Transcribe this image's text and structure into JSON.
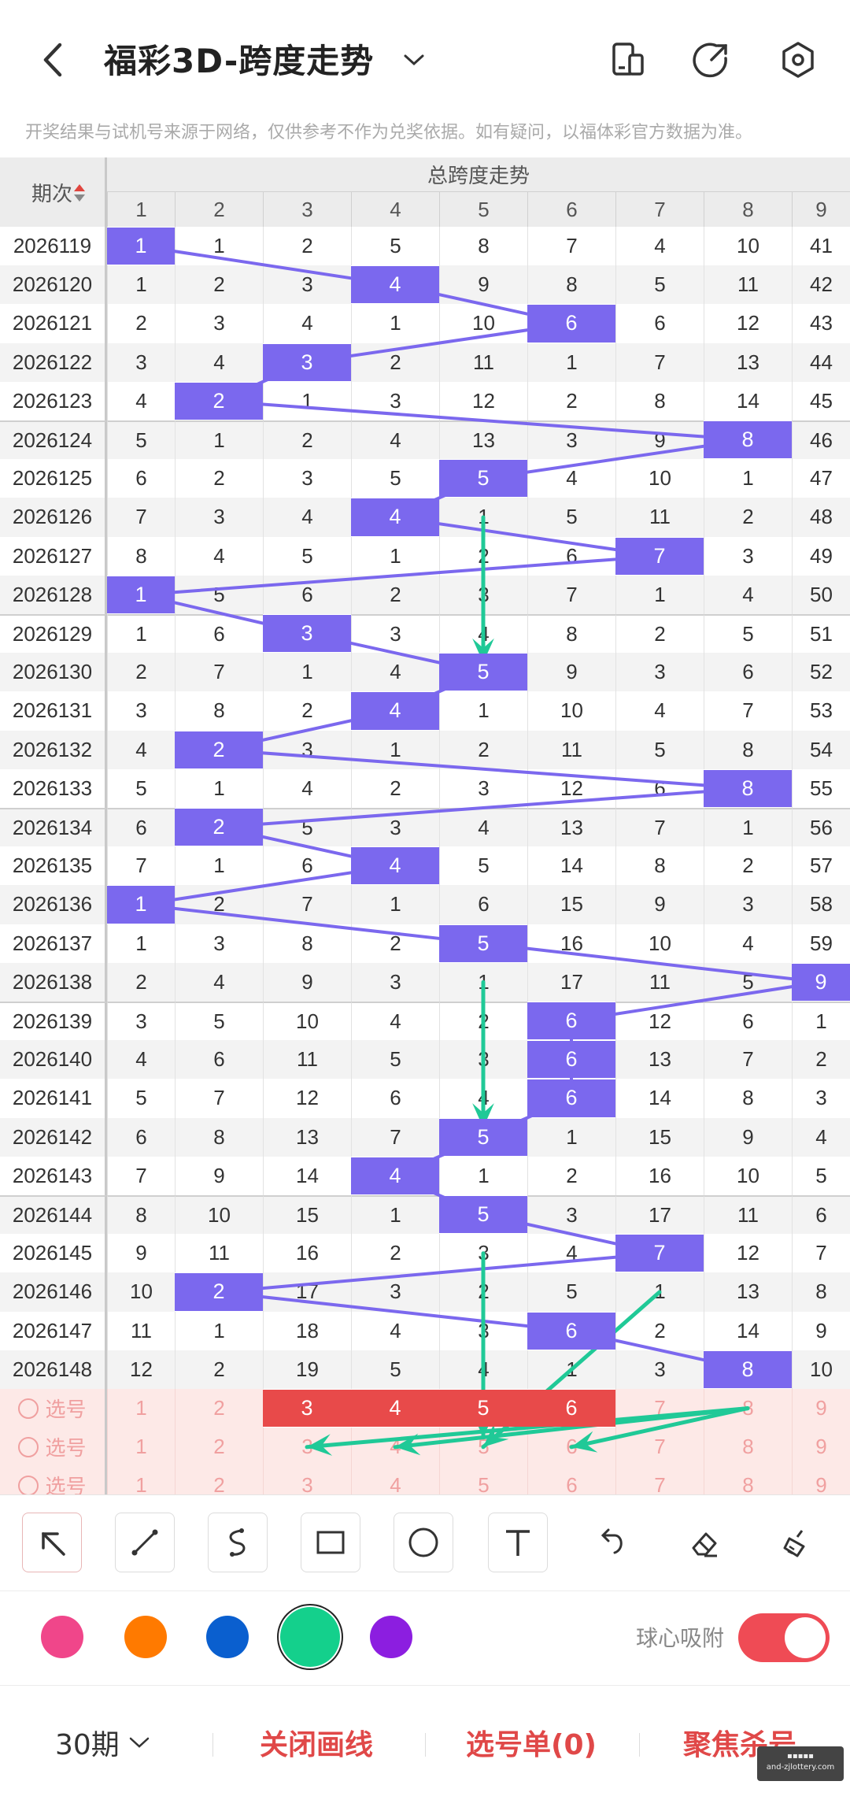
{
  "header": {
    "title": "福彩3D-跨度走势",
    "back_icon": "back-arrow-icon",
    "icons": [
      "layout-icon",
      "share-icon",
      "settings-hex-icon"
    ]
  },
  "notice": "开奖结果与试机号来源于网络，仅供参考不作为兑奖依据。如有疑问，以福体彩官方数据为准。",
  "table": {
    "period_header": "期次",
    "group_header": "总跨度走势",
    "columns": [
      "1",
      "2",
      "3",
      "4",
      "5",
      "6",
      "7",
      "8",
      "9"
    ],
    "rows": [
      {
        "period": "2026119",
        "vals": [
          "1",
          "1",
          "2",
          "5",
          "8",
          "7",
          "4",
          "10",
          "41"
        ],
        "hit": 1
      },
      {
        "period": "2026120",
        "vals": [
          "1",
          "2",
          "3",
          "4",
          "9",
          "8",
          "5",
          "11",
          "42"
        ],
        "hit": 4
      },
      {
        "period": "2026121",
        "vals": [
          "2",
          "3",
          "4",
          "1",
          "10",
          "6",
          "6",
          "12",
          "43"
        ],
        "hit": 6
      },
      {
        "period": "2026122",
        "vals": [
          "3",
          "4",
          "3",
          "2",
          "11",
          "1",
          "7",
          "13",
          "44"
        ],
        "hit": 3
      },
      {
        "period": "2026123",
        "vals": [
          "4",
          "2",
          "1",
          "3",
          "12",
          "2",
          "8",
          "14",
          "45"
        ],
        "hit": 2
      },
      {
        "period": "2026124",
        "vals": [
          "5",
          "1",
          "2",
          "4",
          "13",
          "3",
          "9",
          "8",
          "46"
        ],
        "hit": 8
      },
      {
        "period": "2026125",
        "vals": [
          "6",
          "2",
          "3",
          "5",
          "5",
          "4",
          "10",
          "1",
          "47"
        ],
        "hit": 5
      },
      {
        "period": "2026126",
        "vals": [
          "7",
          "3",
          "4",
          "4",
          "1",
          "5",
          "11",
          "2",
          "48"
        ],
        "hit": 4
      },
      {
        "period": "2026127",
        "vals": [
          "8",
          "4",
          "5",
          "1",
          "2",
          "6",
          "7",
          "3",
          "49"
        ],
        "hit": 7
      },
      {
        "period": "2026128",
        "vals": [
          "1",
          "5",
          "6",
          "2",
          "3",
          "7",
          "1",
          "4",
          "50"
        ],
        "hit": 1
      },
      {
        "period": "2026129",
        "vals": [
          "1",
          "6",
          "3",
          "3",
          "4",
          "8",
          "2",
          "5",
          "51"
        ],
        "hit": 3
      },
      {
        "period": "2026130",
        "vals": [
          "2",
          "7",
          "1",
          "4",
          "5",
          "9",
          "3",
          "6",
          "52"
        ],
        "hit": 5
      },
      {
        "period": "2026131",
        "vals": [
          "3",
          "8",
          "2",
          "4",
          "1",
          "10",
          "4",
          "7",
          "53"
        ],
        "hit": 4
      },
      {
        "period": "2026132",
        "vals": [
          "4",
          "2",
          "3",
          "1",
          "2",
          "11",
          "5",
          "8",
          "54"
        ],
        "hit": 2
      },
      {
        "period": "2026133",
        "vals": [
          "5",
          "1",
          "4",
          "2",
          "3",
          "12",
          "6",
          "8",
          "55"
        ],
        "hit": 8
      },
      {
        "period": "2026134",
        "vals": [
          "6",
          "2",
          "5",
          "3",
          "4",
          "13",
          "7",
          "1",
          "56"
        ],
        "hit": 2
      },
      {
        "period": "2026135",
        "vals": [
          "7",
          "1",
          "6",
          "4",
          "5",
          "14",
          "8",
          "2",
          "57"
        ],
        "hit": 4
      },
      {
        "period": "2026136",
        "vals": [
          "1",
          "2",
          "7",
          "1",
          "6",
          "15",
          "9",
          "3",
          "58"
        ],
        "hit": 1
      },
      {
        "period": "2026137",
        "vals": [
          "1",
          "3",
          "8",
          "2",
          "5",
          "16",
          "10",
          "4",
          "59"
        ],
        "hit": 5
      },
      {
        "period": "2026138",
        "vals": [
          "2",
          "4",
          "9",
          "3",
          "1",
          "17",
          "11",
          "5",
          "9"
        ],
        "hit": 9
      },
      {
        "period": "2026139",
        "vals": [
          "3",
          "5",
          "10",
          "4",
          "2",
          "6",
          "12",
          "6",
          "1"
        ],
        "hit": 6
      },
      {
        "period": "2026140",
        "vals": [
          "4",
          "6",
          "11",
          "5",
          "3",
          "6",
          "13",
          "7",
          "2"
        ],
        "hit": 6
      },
      {
        "period": "2026141",
        "vals": [
          "5",
          "7",
          "12",
          "6",
          "4",
          "6",
          "14",
          "8",
          "3"
        ],
        "hit": 6
      },
      {
        "period": "2026142",
        "vals": [
          "6",
          "8",
          "13",
          "7",
          "5",
          "1",
          "15",
          "9",
          "4"
        ],
        "hit": 5
      },
      {
        "period": "2026143",
        "vals": [
          "7",
          "9",
          "14",
          "4",
          "1",
          "2",
          "16",
          "10",
          "5"
        ],
        "hit": 4
      },
      {
        "period": "2026144",
        "vals": [
          "8",
          "10",
          "15",
          "1",
          "5",
          "3",
          "17",
          "11",
          "6"
        ],
        "hit": 5
      },
      {
        "period": "2026145",
        "vals": [
          "9",
          "11",
          "16",
          "2",
          "3",
          "4",
          "7",
          "12",
          "7"
        ],
        "hit": 7
      },
      {
        "period": "2026146",
        "vals": [
          "10",
          "2",
          "17",
          "3",
          "2",
          "5",
          "1",
          "13",
          "8"
        ],
        "hit": 2
      },
      {
        "period": "2026147",
        "vals": [
          "11",
          "1",
          "18",
          "4",
          "3",
          "6",
          "2",
          "14",
          "9"
        ],
        "hit": 6
      },
      {
        "period": "2026148",
        "vals": [
          "12",
          "2",
          "19",
          "5",
          "4",
          "1",
          "3",
          "8",
          "10"
        ],
        "hit": 8
      }
    ],
    "select_rows": [
      {
        "label": "选号",
        "vals": [
          "1",
          "2",
          "3",
          "4",
          "5",
          "6",
          "7",
          "8",
          "9"
        ],
        "selected": [
          3,
          4,
          5,
          6
        ]
      },
      {
        "label": "选号",
        "vals": [
          "1",
          "2",
          "3",
          "4",
          "5",
          "6",
          "7",
          "8",
          "9"
        ],
        "selected": []
      },
      {
        "label": "选号",
        "vals": [
          "1",
          "2",
          "3",
          "4",
          "5",
          "6",
          "7",
          "8",
          "9"
        ],
        "selected": []
      }
    ]
  },
  "drawing": {
    "arrows": [
      {
        "from": [
          5,
          7
        ],
        "to": [
          5,
          11
        ]
      },
      {
        "from": [
          5,
          19
        ],
        "to": [
          5,
          23
        ]
      },
      {
        "from": [
          5,
          26
        ],
        "to": [
          5,
          31
        ]
      },
      {
        "from": [
          7,
          27
        ],
        "to": [
          5,
          31
        ]
      },
      {
        "from": [
          8,
          30
        ],
        "to": [
          3,
          31
        ]
      },
      {
        "from": [
          8,
          30
        ],
        "to": [
          4,
          31
        ]
      },
      {
        "from": [
          8,
          30
        ],
        "to": [
          6,
          31
        ]
      }
    ],
    "arrow_color": "#20c997"
  },
  "tools": [
    {
      "name": "select-arrow-icon",
      "active": true
    },
    {
      "name": "line-icon"
    },
    {
      "name": "curve-icon"
    },
    {
      "name": "rectangle-icon"
    },
    {
      "name": "circle-icon"
    },
    {
      "name": "text-icon"
    },
    {
      "name": "undo-icon"
    },
    {
      "name": "eraser-icon"
    },
    {
      "name": "clear-brush-icon"
    }
  ],
  "colors": [
    "#f0468a",
    "#ff7a00",
    "#0a5fcf",
    "#14d08c",
    "#8c1ee0"
  ],
  "selected_color_index": 3,
  "snap_label": "球心吸附",
  "snap_enabled": true,
  "bottom": {
    "period_select": "30期",
    "close_line": "关闭画线",
    "selection": "选号单(0)",
    "focus_kill": "聚焦杀号"
  },
  "theme": {
    "hit": "#7b68ee",
    "line": "#7b68ee",
    "select_hit": "#e84a4a",
    "select_bg": "#fde9e7",
    "select_text": "#f0a0a0"
  },
  "watermark": "and-zjlottery.com"
}
